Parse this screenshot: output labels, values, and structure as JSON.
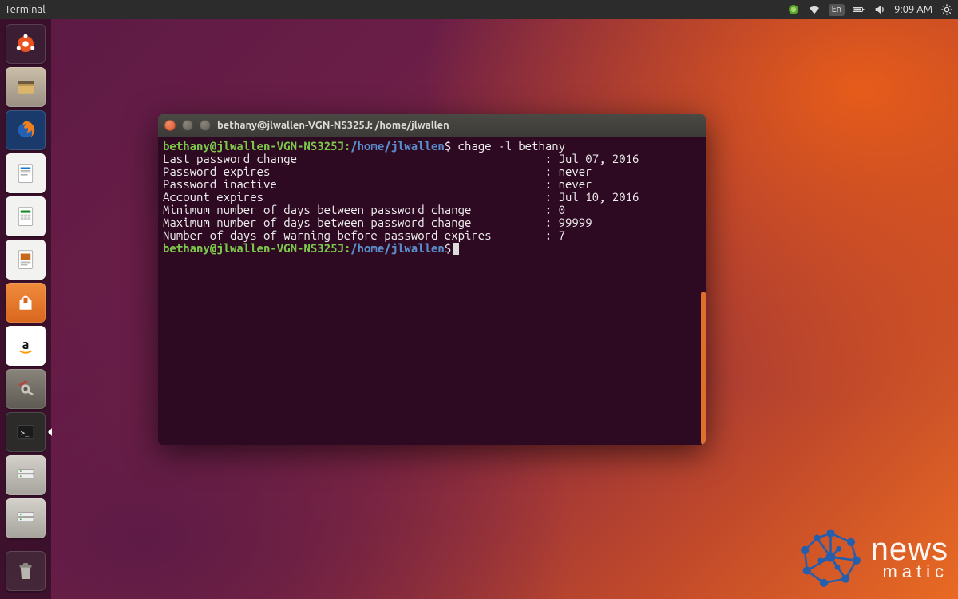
{
  "menubar": {
    "app_label": "Terminal",
    "keyboard_ind": "En",
    "clock": "9:09 AM"
  },
  "launcher": {
    "items": [
      {
        "name": "dash",
        "color": "#3b1e33"
      },
      {
        "name": "files",
        "color": "#9a8f82"
      },
      {
        "name": "firefox",
        "color": "#1b3b6b"
      },
      {
        "name": "writer",
        "color": "#0f5aa8"
      },
      {
        "name": "calc",
        "color": "#1a8a2a"
      },
      {
        "name": "impress",
        "color": "#c7681a"
      },
      {
        "name": "software",
        "color": "#d96a1f"
      },
      {
        "name": "amazon",
        "color": "#f4f4f4"
      },
      {
        "name": "settings",
        "color": "#6a6660"
      },
      {
        "name": "terminal",
        "color": "#2c2b29"
      },
      {
        "name": "serverA",
        "color": "#b7b4ae"
      },
      {
        "name": "serverB",
        "color": "#b7b4ae"
      }
    ]
  },
  "terminal": {
    "title": "bethany@jlwallen-VGN-NS325J: /home/jlwallen",
    "prompt_user": "bethany@jlwallen-VGN-NS325J",
    "prompt_path": "/home/jlwallen",
    "prompt_sym": "$",
    "command": "chage -l bethany",
    "rows": [
      {
        "label": "Last password change",
        "value": "Jul 07, 2016"
      },
      {
        "label": "Password expires",
        "value": "never"
      },
      {
        "label": "Password inactive",
        "value": "never"
      },
      {
        "label": "Account expires",
        "value": "Jul 10, 2016"
      },
      {
        "label": "Minimum number of days between password change",
        "value": "0"
      },
      {
        "label": "Maximum number of days between password change",
        "value": "99999"
      },
      {
        "label": "Number of days of warning before password expires",
        "value": "7"
      }
    ]
  },
  "watermark": {
    "line1": "news",
    "line2": "matic"
  }
}
